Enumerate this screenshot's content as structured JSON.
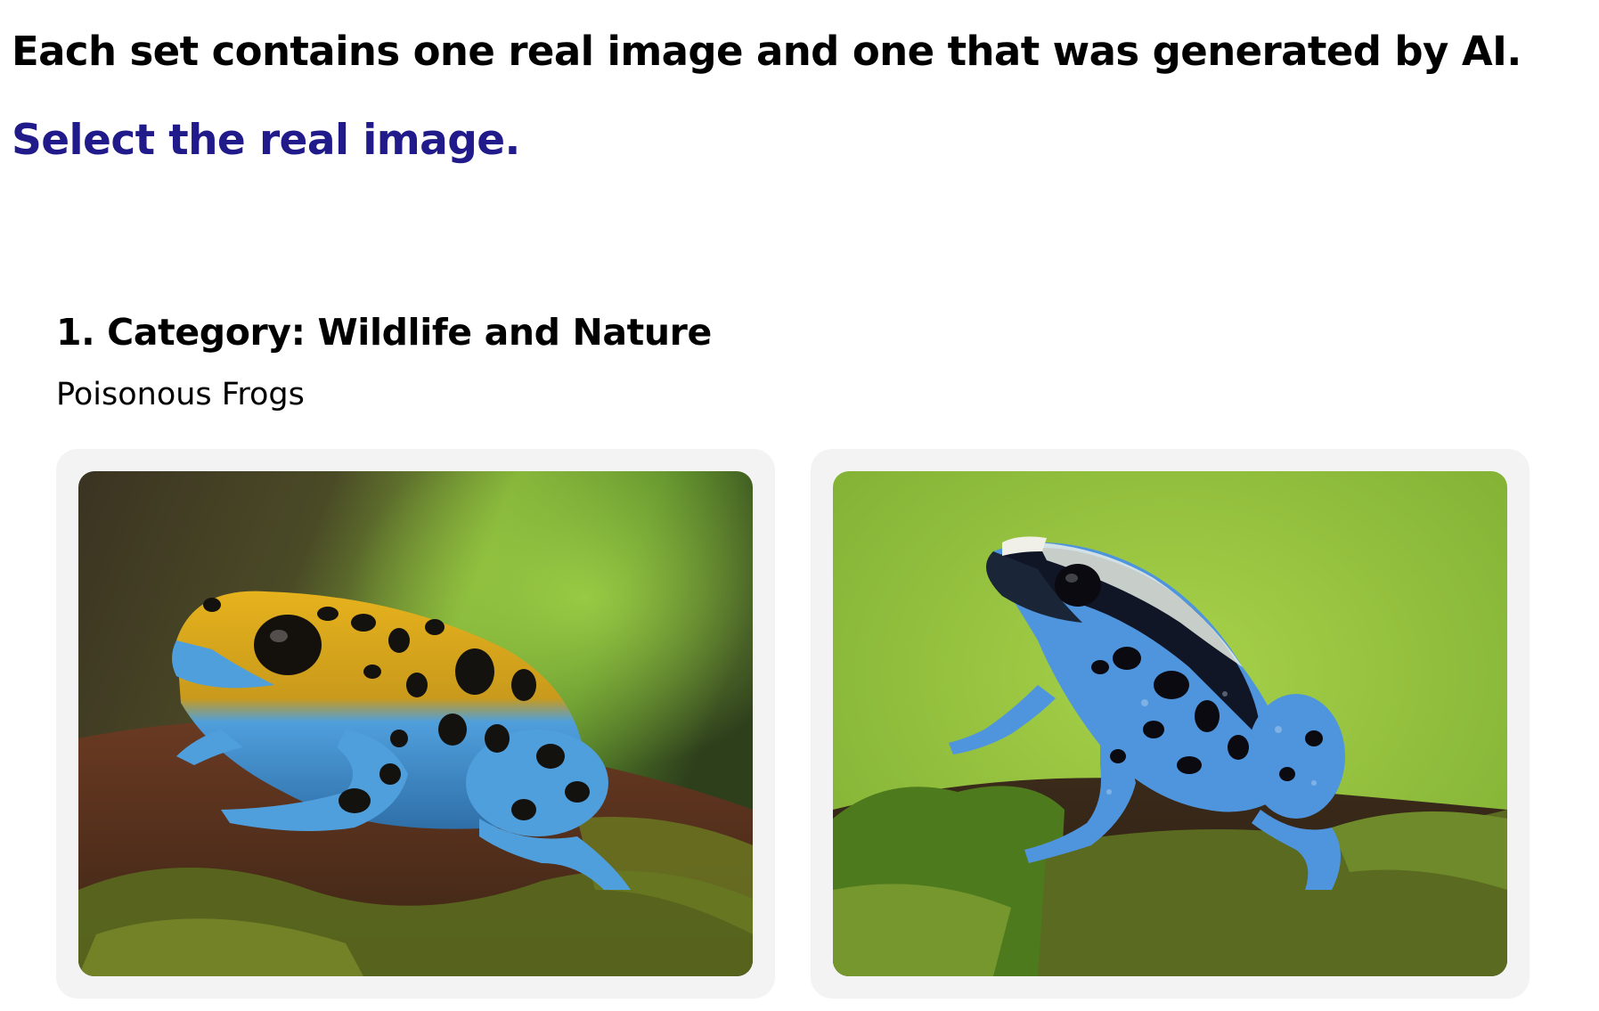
{
  "header": {
    "intro": "Each set contains one real image and one that was generated by AI.",
    "instruction": "Select the real image."
  },
  "question": {
    "title": "1. Category: Wildlife and Nature",
    "subtitle": "Poisonous Frogs",
    "choices": [
      {
        "image": "poison-dart-frog-photo-yellow-blue",
        "colors": {
          "body": "#4a9ad8",
          "back": "#e8b020",
          "spots": "#14120f",
          "background": "#3a5a20"
        }
      },
      {
        "image": "poison-dart-frog-photo-blue-black",
        "colors": {
          "body": "#5aa0e8",
          "back": "#101626",
          "spots": "#0a0a10",
          "background": "#9ec840"
        }
      }
    ]
  },
  "theme": {
    "instruction_color": "#201a8a",
    "card_background": "#f3f3f3"
  }
}
